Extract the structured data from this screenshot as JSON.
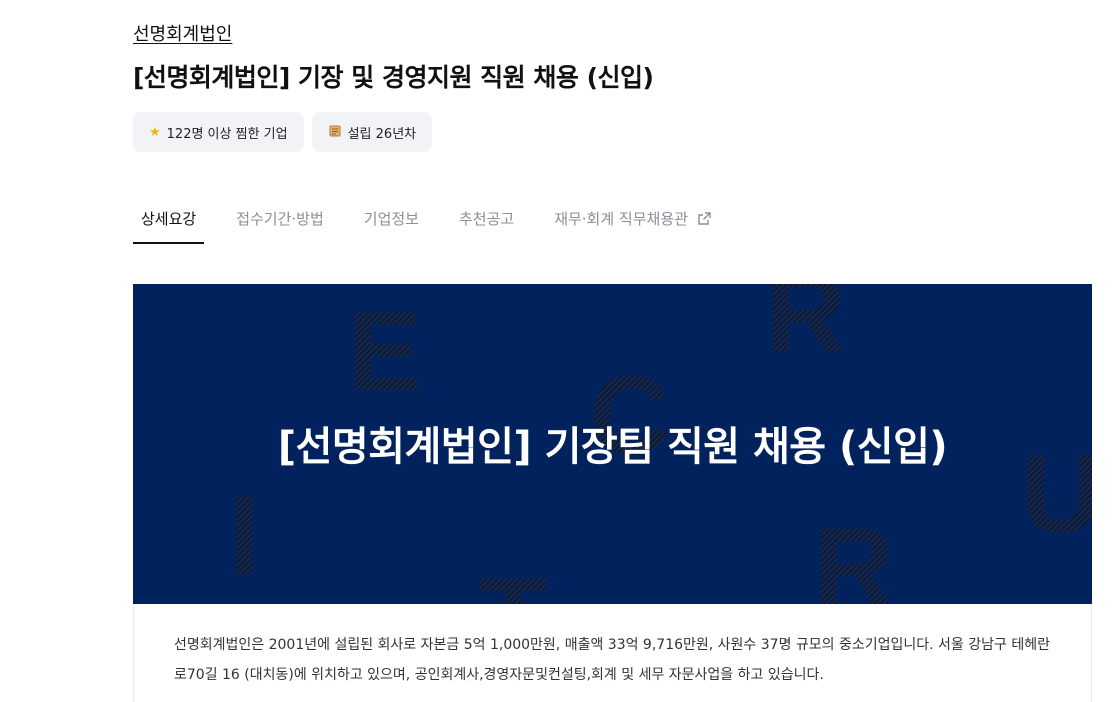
{
  "company": {
    "name": "선명회계법인"
  },
  "job": {
    "title": "[선명회계법인] 기장 및 경영지원 직원 채용 (신입)"
  },
  "badges": [
    {
      "icon": "star-icon",
      "label": "122명 이상 찜한 기업"
    },
    {
      "icon": "scroll-icon",
      "label": "설립 26년차"
    }
  ],
  "tabs": [
    {
      "label": "상세요강",
      "active": true
    },
    {
      "label": "접수기간·방법"
    },
    {
      "label": "기업정보"
    },
    {
      "label": "추천공고"
    },
    {
      "label": "재무·회계 직무채용관",
      "icon": "external-link-icon"
    }
  ],
  "banner": {
    "title": "[선명회계법인] 기장팀 직원 채용 (신입)",
    "background_color": "#02225e",
    "decor_letters": [
      "E",
      "R",
      "C",
      "I",
      "U",
      "R",
      "T"
    ]
  },
  "description": {
    "text": "선명회계법인은 2001년에 설립된 회사로 자본금 5억 1,000만원, 매출액 33억 9,716만원, 사원수 37명 규모의 중소기업입니다. 서울 강남구 테헤란로70길 16 (대치동)에 위치하고 있으며, 공인회계사,경영자문및컨설팅,회계 및 세무 자문사업을 하고 있습니다."
  }
}
